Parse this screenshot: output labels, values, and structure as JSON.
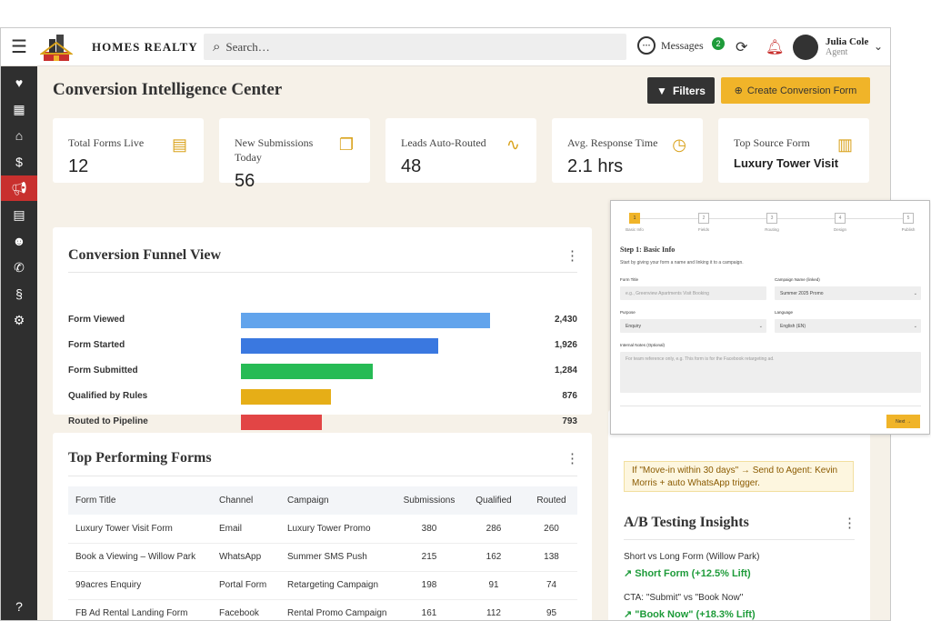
{
  "header": {
    "brand": "HOMES REALTY",
    "search_placeholder": "Search…",
    "messages_label": "Messages",
    "messages_count": "2",
    "user_name": "Julia Cole",
    "user_role": "Agent"
  },
  "sidebar": {
    "items": [
      "heart-icon",
      "dashboard-icon",
      "properties-icon",
      "dollar-icon",
      "megaphone-icon",
      "building-icon",
      "contacts-icon",
      "phone-icon",
      "invoice-icon",
      "gear-icon",
      "help-icon"
    ],
    "active": "megaphone-icon"
  },
  "page": {
    "title": "Conversion Intelligence Center",
    "filters_label": "Filters",
    "create_label": "Create Conversion Form"
  },
  "kpis": [
    {
      "label": "Total Forms Live",
      "value": "12"
    },
    {
      "label": "New Submissions Today",
      "value": "56"
    },
    {
      "label": "Leads Auto-Routed",
      "value": "48"
    },
    {
      "label": "Avg. Response Time",
      "value": "2.1 hrs"
    },
    {
      "label": "Top Source Form",
      "value": "Luxury Tower Visit"
    }
  ],
  "funnel": {
    "title": "Conversion Funnel View",
    "rows": [
      {
        "label": "Form Viewed",
        "value": "2,430",
        "count": 2430,
        "color": "#62a4ec"
      },
      {
        "label": "Form Started",
        "value": "1,926",
        "count": 1926,
        "color": "#3a78e0"
      },
      {
        "label": "Form Submitted",
        "value": "1,284",
        "count": 1284,
        "color": "#27bb55"
      },
      {
        "label": "Qualified by Rules",
        "value": "876",
        "count": 876,
        "color": "#e6ae17"
      },
      {
        "label": "Routed to Pipeline",
        "value": "793",
        "count": 793,
        "color": "#e24545"
      }
    ]
  },
  "forms": {
    "title": "Top Performing Forms",
    "headers": [
      "Form Title",
      "Channel",
      "Campaign",
      "Submissions",
      "Qualified",
      "Routed"
    ],
    "rows": [
      [
        "Luxury Tower Visit Form",
        "Email",
        "Luxury Tower Promo",
        "380",
        "286",
        "260"
      ],
      [
        "Book a Viewing – Willow Park",
        "WhatsApp",
        "Summer SMS Push",
        "215",
        "162",
        "138"
      ],
      [
        "99acres Enquiry",
        "Portal Form",
        "Retargeting Campaign",
        "198",
        "91",
        "74"
      ],
      [
        "FB Ad Rental Landing Form",
        "Facebook",
        "Rental Promo Campaign",
        "161",
        "112",
        "95"
      ]
    ]
  },
  "wizard": {
    "steps": [
      {
        "n": "1",
        "label": "Basic Info"
      },
      {
        "n": "2",
        "label": "Fields"
      },
      {
        "n": "3",
        "label": "Routing"
      },
      {
        "n": "4",
        "label": "Design"
      },
      {
        "n": "5",
        "label": "Publish"
      }
    ],
    "title": "Step 1: Basic Info",
    "subtitle": "Start by giving your form a name and linking it to a campaign.",
    "form_title_label": "Form Title",
    "form_title_placeholder": "e.g., Greenview Apartments Visit Booking",
    "campaign_label": "Campaign Name (linked)",
    "campaign_value": "Summer 2025 Promo",
    "purpose_label": "Purpose",
    "purpose_value": "Enquiry",
    "language_label": "Language",
    "language_value": "English (EN)",
    "notes_label": "Internal Notes (Optional)",
    "notes_placeholder": "For team reference only, e.g. This form is for the Facebook retargeting ad.",
    "next_label": "Next →"
  },
  "rule_text": "If \"Move-in within 30 days\" → Send to Agent: Kevin Morris + auto WhatsApp trigger.",
  "ab": {
    "title": "A/B Testing Insights",
    "items": [
      {
        "test": "Short vs Long Form (Willow Park)",
        "winner": "Short Form (+12.5% Lift)"
      },
      {
        "test": "CTA: \"Submit\" vs \"Book Now\"",
        "winner": "\"Book Now\" (+18.3% Lift)"
      }
    ]
  },
  "colors": {
    "accent": "#f0b429",
    "sidebar": "#2f2f2f",
    "active": "#c8302e",
    "success": "#1e9b3a"
  }
}
